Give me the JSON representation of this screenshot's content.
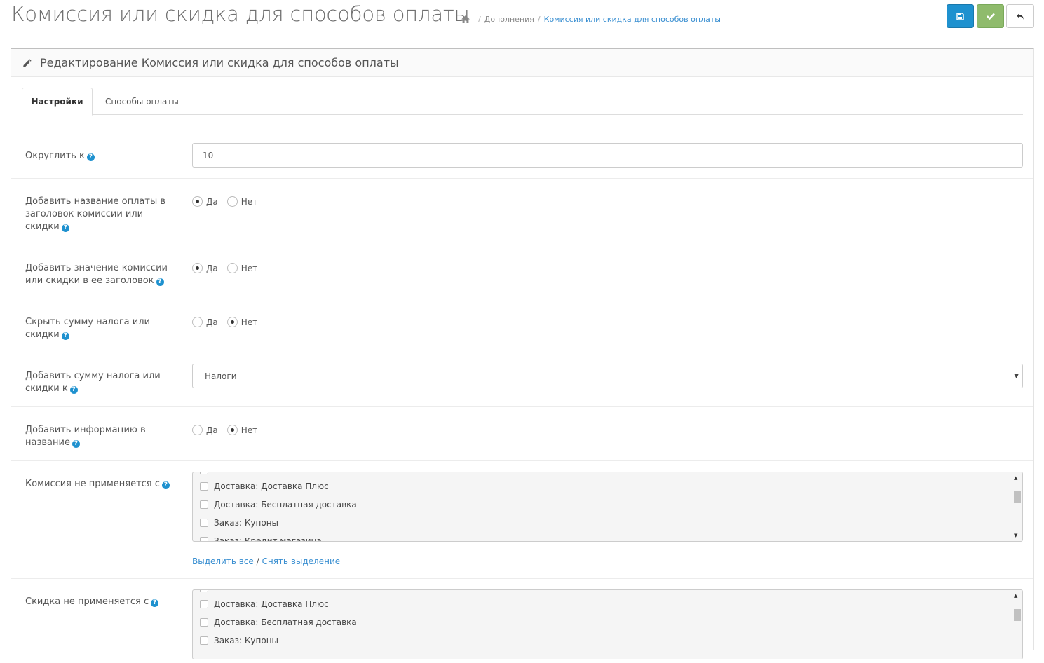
{
  "header": {
    "title": "Комиссия или скидка для способов оплаты",
    "breadcrumb": [
      {
        "label": "Дополнения"
      },
      {
        "label": "Комиссия или скидка для способов оплаты"
      }
    ]
  },
  "panel": {
    "title": "Редактирование Комиссия или скидка для способов оплаты"
  },
  "tabs": [
    {
      "label": "Настройки",
      "active": true
    },
    {
      "label": "Способы оплаты",
      "active": false
    }
  ],
  "form": {
    "round_to": {
      "label": "Округлить к",
      "value": "10"
    },
    "add_payment_name": {
      "label": "Добавить название оплаты в заголовок комиссии или скидки",
      "yes": "Да",
      "no": "Нет",
      "selected": "yes"
    },
    "add_fee_value": {
      "label": "Добавить значение комиссии или скидки в ее заголовок",
      "yes": "Да",
      "no": "Нет",
      "selected": "yes"
    },
    "hide_tax": {
      "label": "Скрыть сумму налога или скидки",
      "yes": "Да",
      "no": "Нет",
      "selected": "no"
    },
    "add_tax_to": {
      "label": "Добавить сумму налога или скидки к",
      "value": "Налоги"
    },
    "add_info": {
      "label": "Добавить информацию в название",
      "yes": "Да",
      "no": "Нет",
      "selected": "no"
    },
    "fee_not_applied": {
      "label": "Комиссия не применяется с",
      "items": [
        "Доставка: Доставка Плюс",
        "Доставка: Бесплатная доставка",
        "Заказ: Купоны",
        "Заказ: Кредит магазина"
      ]
    },
    "discount_not_applied": {
      "label": "Скидка не применяется с",
      "items": [
        "Доставка: Доставка Плюс",
        "Доставка: Бесплатная доставка",
        "Заказ: Купоны"
      ]
    },
    "select_all": "Выделить все",
    "separator": "/",
    "deselect_all": "Снять выделение"
  },
  "colors": {
    "primary": "#1e91cf",
    "success": "#8fbb6c",
    "link": "#3a8fd1"
  }
}
